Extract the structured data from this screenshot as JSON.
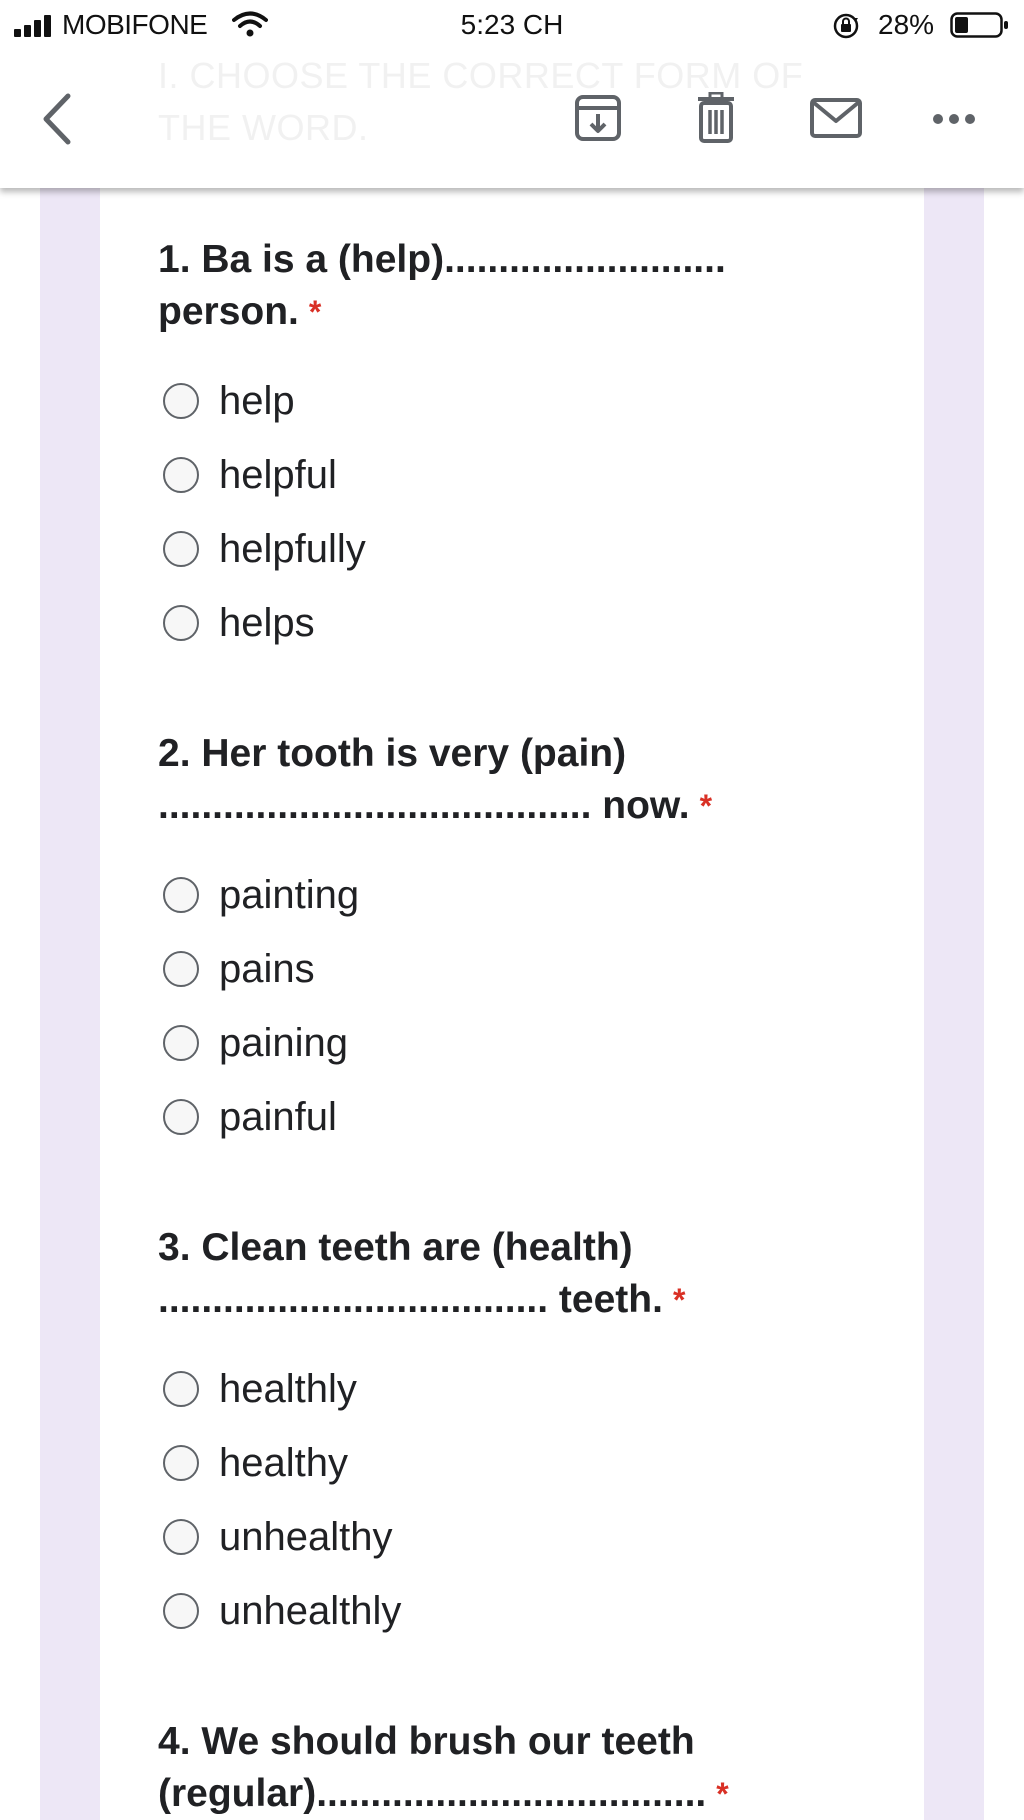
{
  "status_bar": {
    "carrier": "MOBIFONE",
    "time": "5:23 CH",
    "battery": "28%",
    "icons": [
      "signal-icon",
      "wifi-icon",
      "rotation-lock-icon",
      "battery-icon"
    ]
  },
  "toolbar": {
    "faded_title": "I. CHOOSE THE CORRECT FORM OF THE WORD.",
    "icons": [
      "back-icon",
      "archive-icon",
      "trash-icon",
      "mail-icon",
      "more-icon"
    ]
  },
  "colors": {
    "stripe": "#ede7f6",
    "required": "#d93025",
    "text": "#202124"
  },
  "questions": [
    {
      "title_line1": "1. Ba is a (help)..........................",
      "title_line2": "person.",
      "required": "*",
      "options": [
        "help",
        "helpful",
        "helpfully",
        "helps"
      ]
    },
    {
      "title_line1": "2. Her tooth is very (pain)",
      "title_line2": "........................................ now.",
      "required": "*",
      "options": [
        "painting",
        "pains",
        "paining",
        "painful"
      ]
    },
    {
      "title_line1": "3. Clean teeth are (health)",
      "title_line2": ".................................... teeth.",
      "required": "*",
      "options": [
        "healthly",
        "healthy",
        "unhealthy",
        "unhealthly"
      ]
    },
    {
      "title_line1": "4. We should brush our teeth",
      "title_line2": "(regular)....................................",
      "required": "*",
      "options": []
    }
  ]
}
